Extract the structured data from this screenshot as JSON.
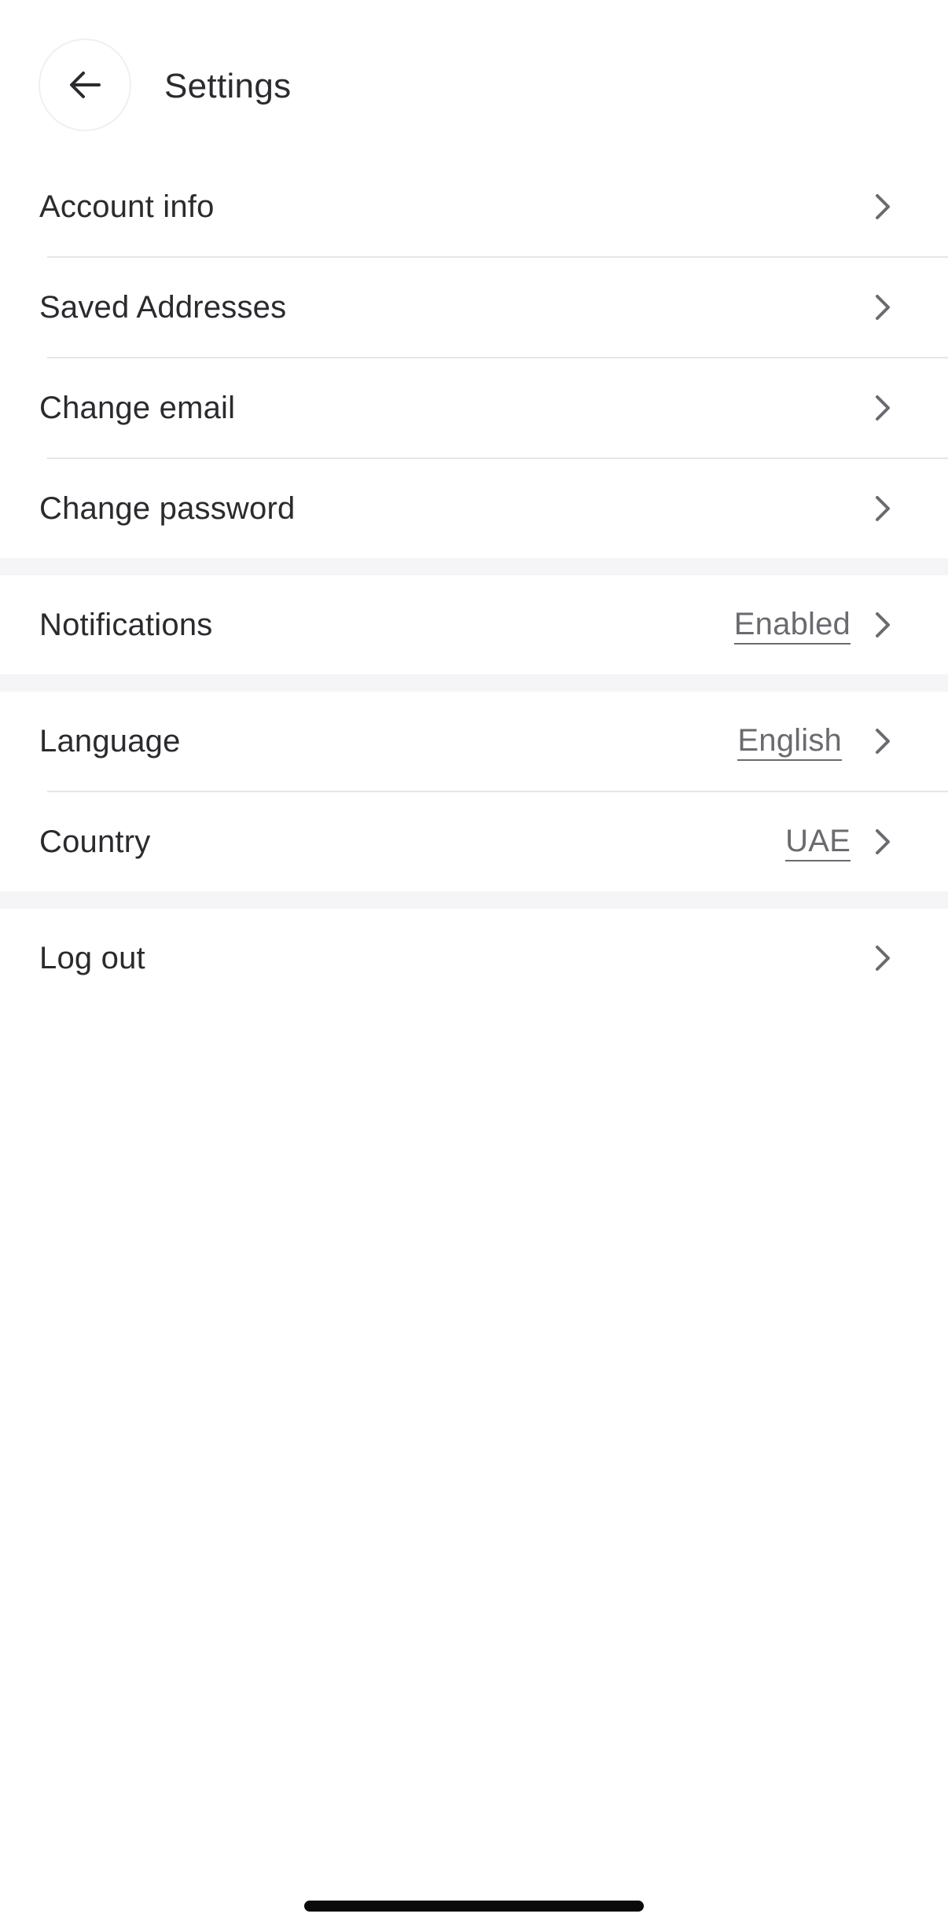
{
  "header": {
    "title": "Settings",
    "back_icon": "arrow-left-icon"
  },
  "sections": [
    {
      "items": [
        {
          "label": "Account info"
        },
        {
          "label": "Saved Addresses"
        },
        {
          "label": "Change email"
        },
        {
          "label": "Change password"
        }
      ]
    },
    {
      "items": [
        {
          "label": "Notifications",
          "value": "Enabled"
        }
      ]
    },
    {
      "items": [
        {
          "label": "Language",
          "value": "English"
        },
        {
          "label": "Country",
          "value": "UAE"
        }
      ]
    },
    {
      "items": [
        {
          "label": "Log out"
        }
      ]
    }
  ],
  "colors": {
    "text": "#2b2a2e",
    "secondary_text": "#6b6a70",
    "divider": "#e6e5e8",
    "section_gap": "#f5f4f6",
    "chevron": "#6b6a70"
  }
}
